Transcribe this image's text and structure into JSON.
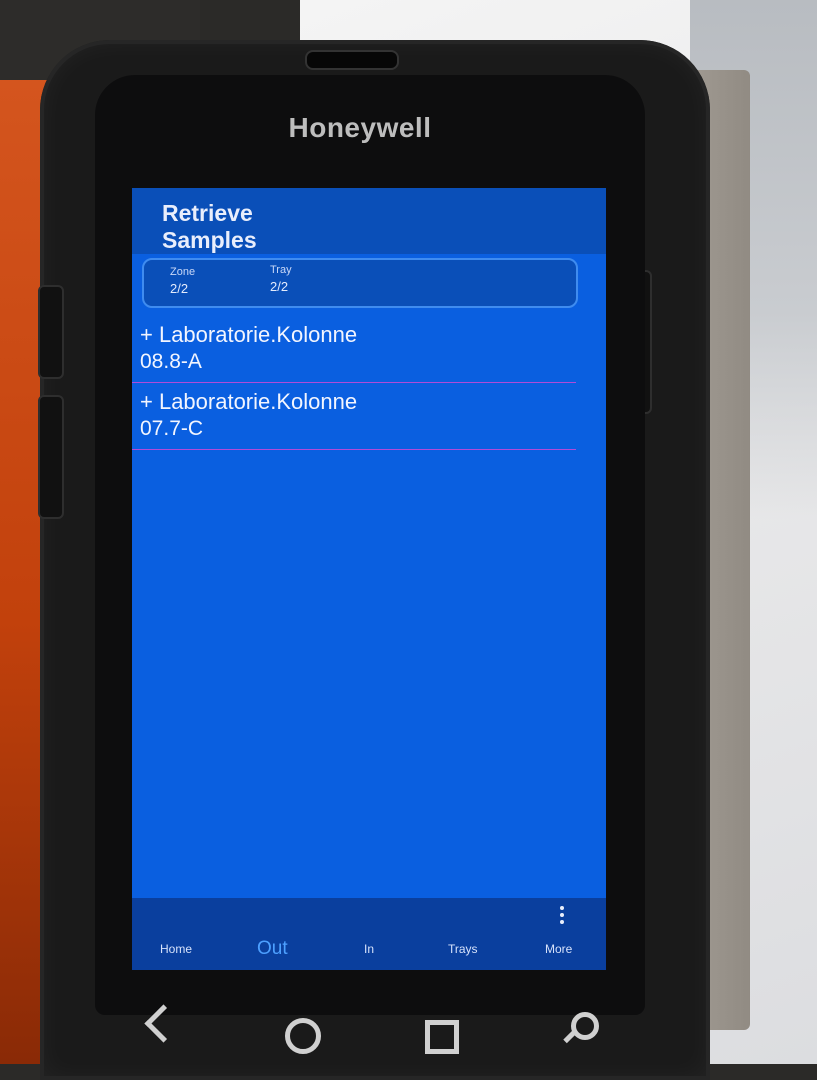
{
  "device": {
    "brand": "Honeywell"
  },
  "app": {
    "title_line1": "Retrieve",
    "title_line2": "Samples",
    "info": {
      "zone_label": "Zone",
      "zone_value": "2/2",
      "tray_label": "Tray",
      "tray_value": "2/2"
    },
    "items": [
      {
        "line1": "+ Laboratorie.Kolonne",
        "line2": "08.8-A"
      },
      {
        "line1": "+ Laboratorie.Kolonne",
        "line2": "07.7-C"
      }
    ],
    "nav": {
      "home": "Home",
      "out": "Out",
      "in": "In",
      "trays": "Trays",
      "more": "More",
      "active": "Out"
    }
  },
  "system_nav": [
    "back-icon",
    "home-icon",
    "recents-icon",
    "search-icon"
  ],
  "colors": {
    "screen": "#0a5fe0",
    "header": "#0a4fb8",
    "nav": "#0a3f9e",
    "divider": "#b04bd8",
    "active_tab": "#4da0ff"
  }
}
